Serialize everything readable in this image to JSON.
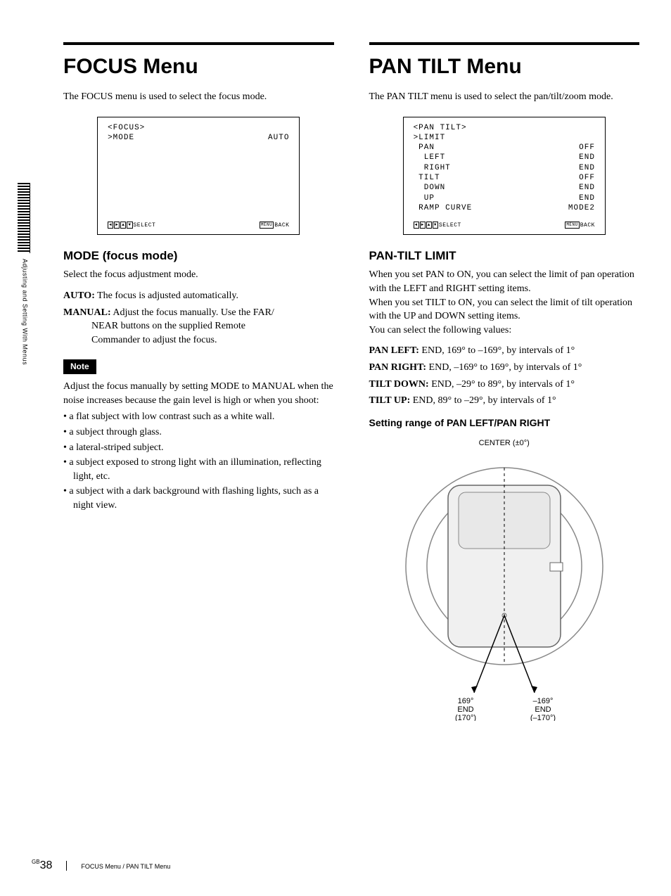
{
  "side_tab": "Adjusting and Setting With Menus",
  "col1": {
    "title": "FOCUS Menu",
    "intro": "The FOCUS menu is used to select the focus mode.",
    "osd": {
      "header": "<FOCUS>",
      "row1_label": ">MODE",
      "row1_value": "AUTO",
      "select": "SELECT",
      "back": "BACK"
    },
    "h2": "MODE (focus mode)",
    "p1": "Select the focus adjustment mode.",
    "auto_label": "AUTO:",
    "auto_text": " The focus is adjusted automatically.",
    "manual_label": "MANUAL:",
    "manual_text": " Adjust the focus manually. Use the FAR/",
    "manual_cont1": "NEAR buttons on the supplied Remote",
    "manual_cont2": "Commander to adjust the focus.",
    "note_badge": "Note",
    "note_intro": "Adjust the focus manually by setting MODE to MANUAL when the noise increases because the gain level is high or when you shoot:",
    "bullets": [
      "a flat subject with low contrast such as a white wall.",
      "a subject through glass.",
      "a lateral-striped subject.",
      "a subject exposed to strong light with an illumination, reflecting light, etc.",
      "a subject with a dark background with flashing lights, such as a night view."
    ]
  },
  "col2": {
    "title": "PAN TILT Menu",
    "intro": "The PAN TILT menu is used to select the pan/tilt/zoom mode.",
    "osd": {
      "header": "<PAN TILT>",
      "r1l": ">LIMIT",
      "r2l": " PAN",
      "r2v": "OFF",
      "r3l": "  LEFT",
      "r3v": "END",
      "r4l": "  RIGHT",
      "r4v": "END",
      "r5l": " TILT",
      "r5v": "OFF",
      "r6l": "  DOWN",
      "r6v": "END",
      "r7l": "  UP",
      "r7v": "END",
      "r8l": " RAMP CURVE",
      "r8v": "MODE2",
      "select": "SELECT",
      "back": "BACK"
    },
    "h2": "PAN-TILT LIMIT",
    "p1": "When you set PAN to ON, you can select the limit of pan operation with the LEFT and RIGHT setting items.",
    "p2": "When you set TILT to ON, you can select the limit of tilt operation with the UP and DOWN setting items.",
    "p3": "You can select the following values:",
    "pl_label": "PAN LEFT:",
    "pl_text": " END, 169° to –169°, by intervals of 1°",
    "pr_label": "PAN RIGHT:",
    "pr_text": " END, –169° to 169°, by intervals of 1°",
    "td_label": "TILT DOWN:",
    "td_text": " END, –29° to 89°, by intervals of 1°",
    "tu_label": "TILT UP:",
    "tu_text": " END, 89° to –29°, by intervals of 1°",
    "sub": "Setting range of PAN LEFT/PAN RIGHT",
    "diag_center": "CENTER (±0°)",
    "diag_left1": "169°",
    "diag_left2": "END",
    "diag_left3": "(170°)",
    "diag_right1": "–169°",
    "diag_right2": "END",
    "diag_right3": "(–170°)"
  },
  "footer": {
    "gb": "GB",
    "page": "38",
    "trail": "FOCUS Menu / PAN TILT Menu"
  }
}
